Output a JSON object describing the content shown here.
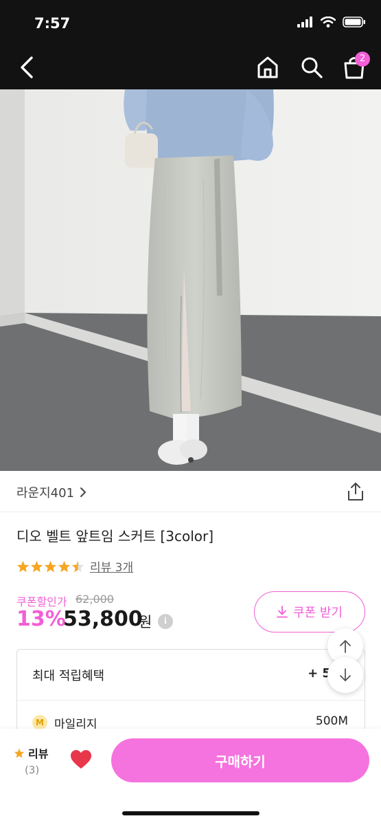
{
  "status_bar": {
    "time": "7:57"
  },
  "nav": {
    "cart_badge": "2"
  },
  "brand": {
    "name": "라운지401"
  },
  "product": {
    "title": "디오 벨트 앞트임 스커트 [3color]",
    "rating": 4.5,
    "review_link": "리뷰 3개",
    "coupon_label": "쿠폰할인가",
    "original_price": "62,000",
    "discount": "13%",
    "price": "53,800",
    "currency": "원"
  },
  "coupon_button": {
    "label": "쿠폰 받기"
  },
  "benefits": {
    "title": "최대 적립혜택",
    "amount": "+ 500",
    "mileage_icon": "M",
    "mileage_label": "마일리지",
    "mileage_value": "500M"
  },
  "bottom_bar": {
    "review_label": "리뷰",
    "review_count": "(3)",
    "buy_label": "구매하기"
  },
  "colors": {
    "accent": "#f25fd6",
    "buy_button": "#f573de",
    "star": "#f5a623",
    "heart": "#e8364a"
  }
}
